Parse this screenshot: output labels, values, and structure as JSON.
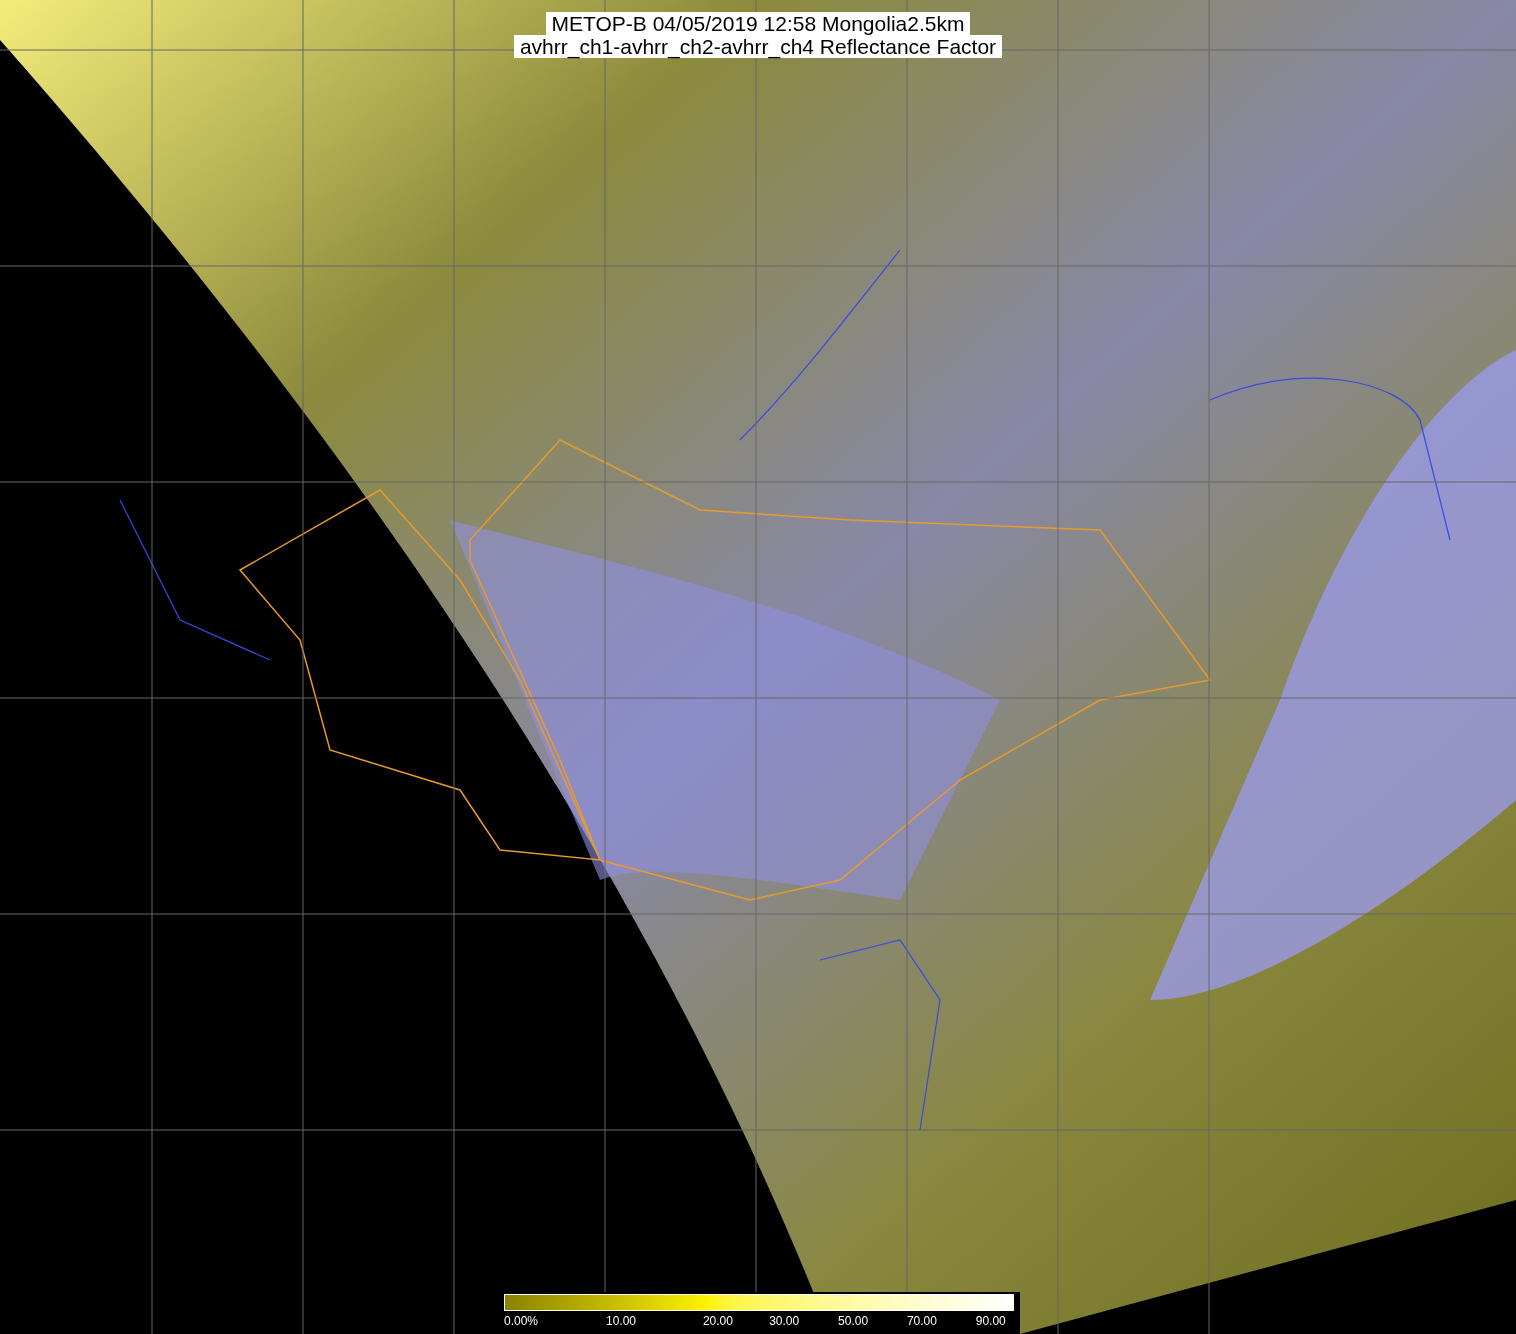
{
  "title": {
    "lines": [
      "METOP-B 04/05/2019 12:58 Mongolia2.5km",
      "avhrr_ch1-avhrr_ch2-avhrr_ch4 Reflectance Factor"
    ]
  },
  "color_scale": {
    "labels": [
      "0.00%",
      "10.00",
      "20.00",
      "30.00",
      "50.00",
      "70.00",
      "90.00"
    ]
  }
}
